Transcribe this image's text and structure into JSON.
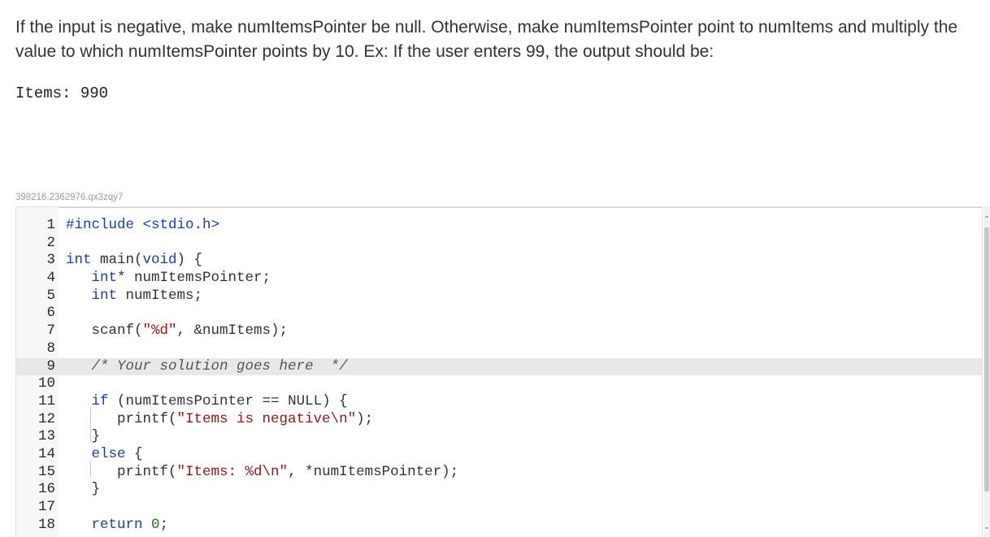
{
  "prompt": {
    "text": "If the input is negative, make numItemsPointer be null. Otherwise, make numItemsPointer point to numItems and multiply the value to which numItemsPointer points by 10. Ex: If the user enters 99, the output should be:"
  },
  "expected_output": "Items: 990",
  "lab_id": "398216.2362976.qx3zqy7",
  "editor": {
    "language": "c",
    "active_line": 9,
    "lines": [
      {
        "n": "1",
        "text": "#include <stdio.h>"
      },
      {
        "n": "2",
        "text": ""
      },
      {
        "n": "3",
        "text": "int main(void) {"
      },
      {
        "n": "4",
        "text": "   int* numItemsPointer;"
      },
      {
        "n": "5",
        "text": "   int numItems;"
      },
      {
        "n": "6",
        "text": ""
      },
      {
        "n": "7",
        "text": "   scanf(\"%d\", &numItems);"
      },
      {
        "n": "8",
        "text": ""
      },
      {
        "n": "9",
        "text": "   /* Your solution goes here  */"
      },
      {
        "n": "10",
        "text": ""
      },
      {
        "n": "11",
        "text": "   if (numItemsPointer == NULL) {"
      },
      {
        "n": "12",
        "text": "      printf(\"Items is negative\\n\");"
      },
      {
        "n": "13",
        "text": "   }"
      },
      {
        "n": "14",
        "text": "   else {"
      },
      {
        "n": "15",
        "text": "      printf(\"Items: %d\\n\", *numItemsPointer);"
      },
      {
        "n": "16",
        "text": "   }"
      },
      {
        "n": "17",
        "text": ""
      },
      {
        "n": "18",
        "text": "   return 0;"
      }
    ]
  }
}
